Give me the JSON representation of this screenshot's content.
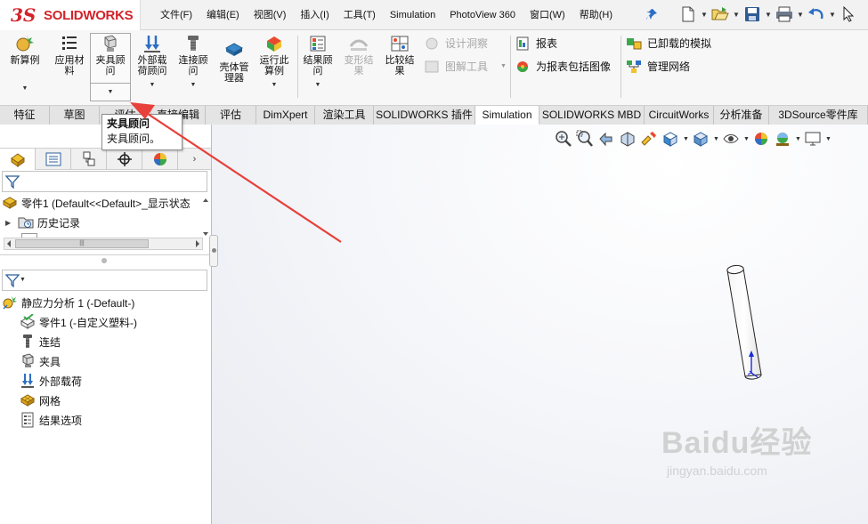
{
  "app": {
    "logo_ds": "3S",
    "logo_name": "SOLIDWORKS"
  },
  "menu": [
    "文件(F)",
    "编辑(E)",
    "视图(V)",
    "插入(I)",
    "工具(T)",
    "Simulation",
    "PhotoView 360",
    "窗口(W)",
    "帮助(H)"
  ],
  "quick_access": [
    "new-icon",
    "open-icon",
    "save-icon",
    "print-icon",
    "undo-icon",
    "select-icon"
  ],
  "commands": {
    "new_study": "新算例",
    "apply_material": "应用材\n料",
    "fixtures_advisor": "夹具顾\n问",
    "external_loads_advisor": "外部载\n荷顾问",
    "connections_advisor": "连接顾\n问",
    "shell_manager": "壳体管\n理器",
    "run_study": "运行此\n算例",
    "results_advisor": "结果顾\n问",
    "deformed_result": "变形结\n果",
    "compare_results": "比较结\n果",
    "design_insight": "设计洞察",
    "plot_tools": "图解工具",
    "report": "报表",
    "include_image_in_report": "为报表包括图像",
    "offloaded_simulations": "已卸载的模拟",
    "manage_network": "管理网络"
  },
  "tabs": [
    "特征",
    "草图",
    "评估",
    "直接编辑",
    "评估",
    "DimXpert",
    "渲染工具",
    "SOLIDWORKS 插件",
    "Simulation",
    "SOLIDWORKS MBD",
    "CircuitWorks",
    "分析准备",
    "3DSource零件库"
  ],
  "active_tab": "Simulation",
  "tooltip": {
    "title": "夹具顾问",
    "body": "夹具顾问。"
  },
  "feature_tree": {
    "part_row": "零件1  (Default<<Default>_显示状态",
    "history": "历史记录"
  },
  "study_tree": {
    "study": "静应力分析 1 (-Default-)",
    "part": "零件1 (-自定义塑料-)",
    "connections": "连结",
    "fixtures": "夹具",
    "external_loads": "外部载荷",
    "mesh": "网格",
    "result_options": "结果选项"
  },
  "watermark": {
    "brand": "Baidu经验",
    "url": "jingyan.baidu.com"
  },
  "colors": {
    "brand_red": "#d2232a",
    "annotation_arrow": "#e8403a",
    "accent_blue": "#2d6fc5"
  }
}
